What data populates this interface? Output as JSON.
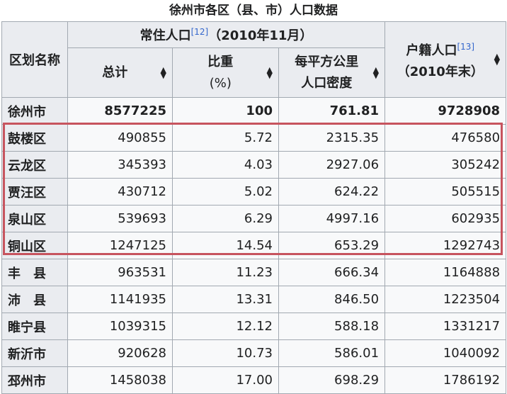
{
  "caption": "徐州市各区（县、市）人口数据",
  "headers": {
    "district": "区划名称",
    "resident": "常住人口",
    "resident_ref": "[12]",
    "resident_date": "（2010年11月）",
    "total": "总计",
    "share_line1": "比重",
    "share_line2": "(%)",
    "density_line1": "每平方公里",
    "density_line2": "人口密度",
    "registered": "户籍人口",
    "registered_ref": "[13]",
    "registered_date": "（2010年末）",
    "sort_up": "▲",
    "sort_down": "▼"
  },
  "rows": [
    {
      "name": "徐州市",
      "total": "8577225",
      "share": "100",
      "density": "761.81",
      "registered": "9728908"
    },
    {
      "name": "鼓楼区",
      "total": "490855",
      "share": "5.72",
      "density": "2315.35",
      "registered": "476580"
    },
    {
      "name": "云龙区",
      "total": "345393",
      "share": "4.03",
      "density": "2927.06",
      "registered": "305242"
    },
    {
      "name": "贾汪区",
      "total": "430712",
      "share": "5.02",
      "density": "624.22",
      "registered": "505515"
    },
    {
      "name": "泉山区",
      "total": "539693",
      "share": "6.29",
      "density": "4997.16",
      "registered": "602935"
    },
    {
      "name": "铜山区",
      "total": "1247125",
      "share": "14.54",
      "density": "653.29",
      "registered": "1292743"
    },
    {
      "name": "丰　县",
      "total": "963531",
      "share": "11.23",
      "density": "666.34",
      "registered": "1164888"
    },
    {
      "name": "沛　县",
      "total": "1141935",
      "share": "13.31",
      "density": "846.50",
      "registered": "1223504"
    },
    {
      "name": "睢宁县",
      "total": "1039315",
      "share": "12.12",
      "density": "588.18",
      "registered": "1331217"
    },
    {
      "name": "新沂市",
      "total": "920628",
      "share": "10.73",
      "density": "586.01",
      "registered": "1040092"
    },
    {
      "name": "邳州市",
      "total": "1458038",
      "share": "17.00",
      "density": "698.29",
      "registered": "1786192"
    }
  ],
  "highlight_color": "#c7545e"
}
